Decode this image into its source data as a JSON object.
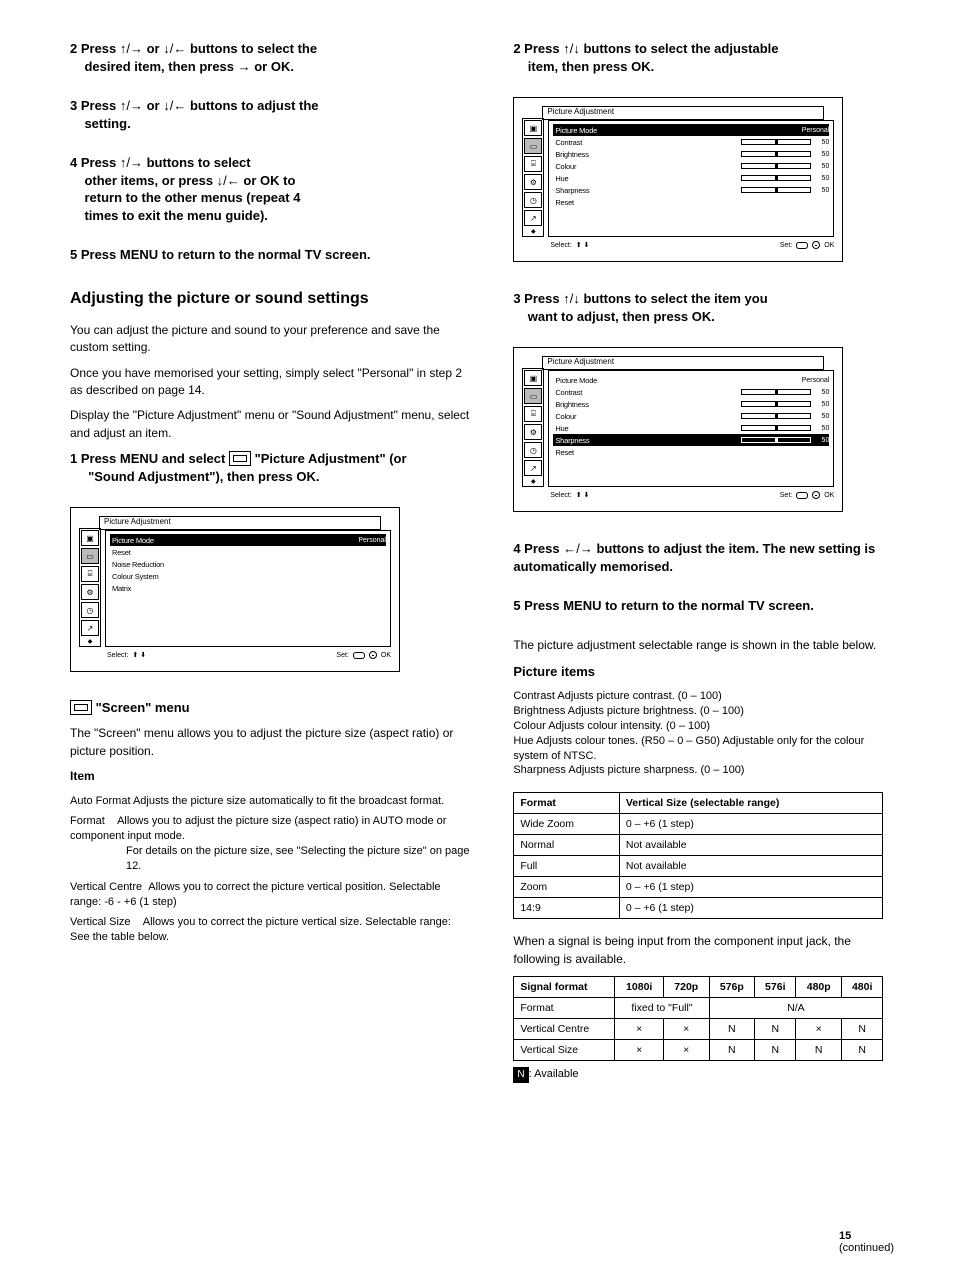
{
  "col_left": {
    "step2_a": "2   Press ",
    "step2_b": " buttons to select the ",
    "step2_c": "desired item, then press ",
    "step2_d": " or OK.",
    "step3_a": "3   Press ",
    "step3_b": " buttons to adjust the ",
    "step3_c": "setting.",
    "step4_a": "4   Press ",
    "step4_b": " buttons to select ",
    "step4_c": "other items, or press ",
    "step4_d": " or OK to ",
    "step4_e": "return to the other menus (repeat 4 ",
    "step4_f": "times to exit the menu guide).",
    "step5": "5   Press MENU to return to the normal TV screen.",
    "section_title": "Adjusting the picture or sound settings",
    "para1": "You can adjust the picture and sound to your preference and save the custom setting.",
    "para1b": "Once you have memorised your setting, simply select \"Personal\" in step 2 as described on page 14.",
    "para2": "Display the \"Picture Adjustment\" menu or \"Sound Adjustment\" menu, select and adjust an item.",
    "step1_a": "1   Press MENU and select  ",
    "step1_b": "  \"Picture Adjustment\" (or  ",
    "step1_c": "  \"Sound Adjustment\"), then press OK.",
    "d1": {
      "title": "Picture Adjustment",
      "rows": [
        "Picture Mode",
        "Reset",
        "Noise Reduction",
        "Colour System",
        "Matrix"
      ],
      "r0v": "Personal",
      "f_sel": "Select:",
      "f_set": "Set:",
      "f_ok": "OK"
    },
    "screen_section": {
      "title": "\"Screen\" menu",
      "text": "The \"Screen\" menu allows you to adjust the picture size (aspect ratio) or picture position.",
      "item": "Item",
      "auto": "Auto Format Adjusts the picture size automatically to fit the broadcast format.",
      "fmt": "Format",
      "fmt_text": "Allows you to adjust the picture size (aspect ratio) in AUTO mode or component input mode.",
      "fmt_more": "For details on the picture size, see \"Selecting the picture size\" on page 12.",
      "centre": "Vertical Centre",
      "centre_text": "Allows you to correct the picture vertical position. Selectable range: -6 - +6 (1 step)",
      "size_hdr": "Vertical Size",
      "size_text": "Allows you to correct the picture vertical size. Selectable range: See the table below."
    }
  },
  "col_right": {
    "step2_a": "2   Press ",
    "step2_b": " buttons to select the adjustable ",
    "step2_c": "item, then press OK.",
    "d2": {
      "title": "Picture Adjustment",
      "rows": [
        "Picture Mode",
        "Contrast",
        "Brightness",
        "Colour",
        "Hue",
        "Sharpness",
        "Reset"
      ],
      "r0v": "Personal",
      "r1v": "50",
      "r2v": "50",
      "r3v": "50",
      "r4v": "50",
      "r5v": "50",
      "f_sel": "Select:",
      "f_set": "Set:",
      "f_ok": "OK"
    },
    "step3_a": "3   Press ",
    "step3_b": " buttons to select the item you ",
    "step3_c": "want to adjust, then press OK.",
    "d3": {
      "title": "Picture Adjustment",
      "rows": [
        "Picture Mode",
        "Contrast",
        "Brightness",
        "Colour",
        "Hue",
        "Sharpness",
        "Reset"
      ],
      "r0v": "Personal",
      "r1v": "50",
      "r2v": "50",
      "r3v": "50",
      "r4v": "50",
      "r5v": "50",
      "f_sel": "Select:",
      "f_set": "Set:",
      "f_ok": "OK"
    },
    "step4_a": "4   Press ",
    "step4_b": " buttons to adjust the item. The new setting is automatically memorised.",
    "step5": "5   Press MENU to return to the normal TV screen.",
    "table_intro": "The picture adjustment selectable range is shown in the table below.",
    "picture_items_hdr": "Picture items",
    "pic_contrast": "Contrast   Adjusts picture contrast. (0 – 100)",
    "pic_bright": "Brightness Adjusts picture brightness. (0 – 100)",
    "pic_colour": "Colour       Adjusts colour intensity. (0 – 100)",
    "pic_hue": "Hue            Adjusts colour tones. (R50 – 0 – G50) Adjustable only for the colour system of NTSC.",
    "pic_sharp": "Sharpness Adjusts picture sharpness. (0 – 100)",
    "sizes": {
      "h1": "Format",
      "h2": "Vertical Size (selectable range)",
      "r1a": "Wide Zoom",
      "r1b": "0 – +6 (1 step)",
      "r2a": "Normal",
      "r2b": "Not available",
      "r3a": "Full",
      "r3b": "Not available",
      "r4a": "Zoom",
      "r4b": "0 – +6 (1 step)",
      "r5a": "14:9",
      "r5b": "0 – +6 (1 step)"
    },
    "comp_intro": "When a signal is being input from the component input jack, the following is available.",
    "comp": {
      "h1": "Signal format",
      "h2": "1080i",
      "h3": "720p",
      "h4": "576p",
      "h5": "576i",
      "h6": "480p",
      "h7": "480i",
      "r1a": "Vertical Centre",
      "r2a": "Vertical Size",
      "na": "N/A",
      "fix": "fixed to \"Full\"",
      "fmt": "Format",
      "x": "×",
      "blackN": "N",
      "blackA": ": Available"
    }
  },
  "footer": {
    "page": "15",
    "cont": "(continued)"
  }
}
